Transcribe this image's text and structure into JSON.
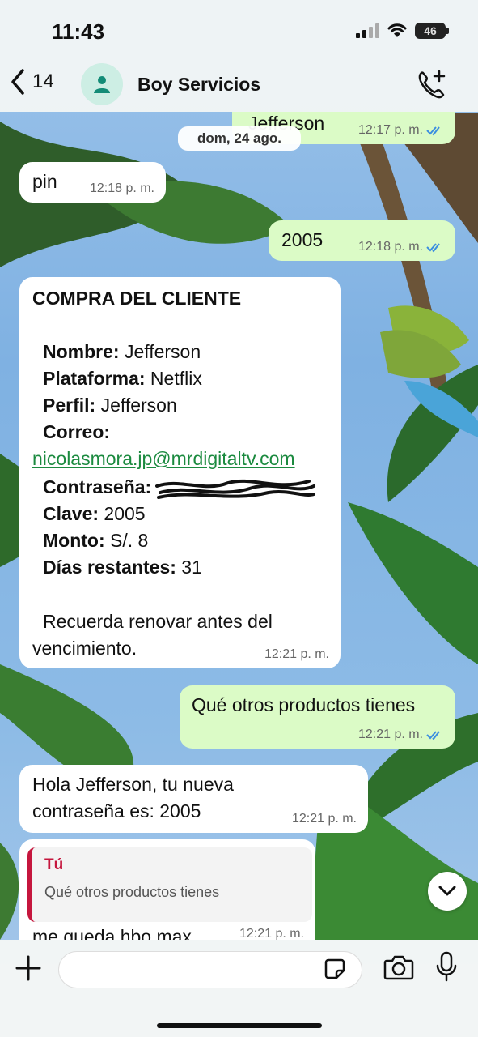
{
  "status_bar": {
    "time": "11:43",
    "battery": "46"
  },
  "header": {
    "back_count": "14",
    "contact_name": "Boy Servicios"
  },
  "date_separator": "dom, 24 ago.",
  "messages": [
    {
      "text": "Jefferson",
      "time": "12:17 p. m."
    },
    {
      "text": "pin",
      "time": "12:18 p. m."
    },
    {
      "text": "2005",
      "time": "12:18 p. m."
    },
    {
      "title": "COMPRA DEL CLIENTE",
      "lines": [
        {
          "label": "Nombre:",
          "value": " Jefferson"
        },
        {
          "label": "Plataforma:",
          "value": " Netflix"
        },
        {
          "label": "Perfil:",
          "value": " Jefferson"
        },
        {
          "label": "Correo:",
          "value": ""
        },
        {
          "label": "Contraseña:",
          "value": ""
        },
        {
          "label": "Clave:",
          "value": " 2005"
        },
        {
          "label": "Monto:",
          "value": " S/. 8"
        },
        {
          "label": "Días restantes:",
          "value": " 31"
        }
      ],
      "email": "nicolasmora.jp@mrdigitaltv.com",
      "footer_line1": "Recuerda renovar antes del",
      "footer_line2": "vencimiento.",
      "time": "12:21 p. m."
    },
    {
      "text": "Qué otros productos tienes",
      "time": "12:21 p. m."
    },
    {
      "line1": "Hola Jefferson, tu nueva",
      "line2": "contraseña es: 2005",
      "time": "12:21 p. m."
    },
    {
      "quote_author": "Tú",
      "quote_text": "Qué otros productos tienes",
      "text": "me queda hbo max",
      "time": "12:21 p. m."
    }
  ],
  "colors": {
    "outgoing": "#dbfbc6",
    "incoming": "#ffffff",
    "read_ticks": "#3b8ee0",
    "link": "#1b8a3f",
    "quote_accent": "#c5163d"
  },
  "icons": [
    "chevron-left-icon",
    "person-icon",
    "phone-plus-icon",
    "double-check-icon",
    "chevron-down-icon",
    "plus-icon",
    "sticker-icon",
    "camera-icon",
    "microphone-icon"
  ]
}
